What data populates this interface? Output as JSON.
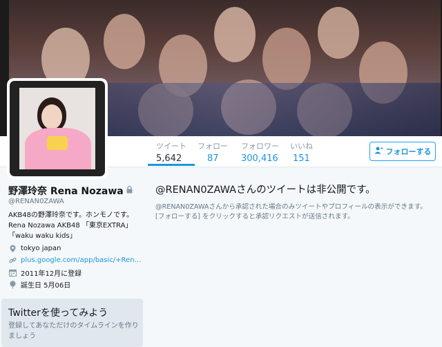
{
  "profile": {
    "name": "野澤玲奈 Rena Nozawa",
    "handle": "@RENAN0ZAWA",
    "bio": [
      "AKB48の野澤玲奈です。ホンモノです。",
      "Rena Nozawa AKB48 「東京EXTRA」",
      "「waku waku kids」"
    ],
    "location": "tokyo japan",
    "url": "plus.google.com/app/basic/+Ren…",
    "joined": "2011年12月に登録",
    "birthday": "誕生日 5月06日"
  },
  "stats": [
    {
      "label": "ツイート",
      "value": "5,642",
      "active": true
    },
    {
      "label": "フォロー",
      "value": "87"
    },
    {
      "label": "フォロワー",
      "value": "300,416"
    },
    {
      "label": "いいね",
      "value": "151"
    }
  ],
  "follow_button": {
    "label": "フォローする",
    "icon": "add-user-icon"
  },
  "protected": {
    "title": "@RENAN0ZAWAさんのツイートは非公開です。",
    "desc_line1": "@RENAN0ZAWAさんから承認された場合のみツイートやプロフィールの表示ができます。",
    "desc_line2": "[フォローする] をクリックすると承認リクエストが送信されます。"
  },
  "signup_card": {
    "title": "Twitterを使ってみよう",
    "desc": "登録してあなただけのタイムラインを作りましょう"
  },
  "colors": {
    "accent": "#1b95e0",
    "background": "#f5f8fa"
  }
}
